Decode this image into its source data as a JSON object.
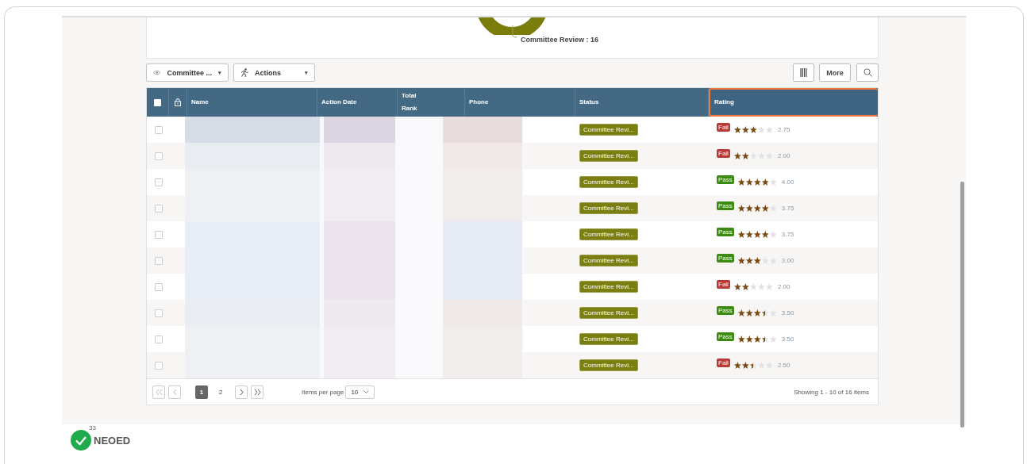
{
  "chart": {
    "label": "Committee Review : 16"
  },
  "toolbar": {
    "view": {
      "label": "Committee ...",
      "caret": "▾"
    },
    "actions": {
      "label": "Actions",
      "caret": "▾"
    },
    "more": {
      "label": "More"
    }
  },
  "table": {
    "header_checkbox": {
      "checked": false
    },
    "columns": [
      {
        "label": "Name",
        "highlighted": false
      },
      {
        "label": "Action Date",
        "highlighted": false
      },
      {
        "label": "Total Rank",
        "highlighted": false
      },
      {
        "label": "Phone",
        "highlighted": false
      },
      {
        "label": "Status",
        "highlighted": false
      },
      {
        "label": "Rating",
        "highlighted": true
      }
    ],
    "rows": [
      {
        "checked": false,
        "status": "Committee Revi...",
        "result": {
          "kind": "fail",
          "label": "Fail"
        },
        "stars": 3,
        "score": "2.75"
      },
      {
        "checked": false,
        "status": "Committee Revi...",
        "result": {
          "kind": "fail",
          "label": "Fail"
        },
        "stars": 2,
        "score": "2.00"
      },
      {
        "checked": false,
        "status": "Committee Revi...",
        "result": {
          "kind": "pass",
          "label": "Pass"
        },
        "stars": 4,
        "score": "4.00"
      },
      {
        "checked": false,
        "status": "Committee Revi...",
        "result": {
          "kind": "pass",
          "label": "Pass"
        },
        "stars": 4,
        "score": "3.75"
      },
      {
        "checked": false,
        "status": "Committee Revi...",
        "result": {
          "kind": "pass",
          "label": "Pass"
        },
        "stars": 4,
        "score": "3.75"
      },
      {
        "checked": false,
        "status": "Committee Revi...",
        "result": {
          "kind": "pass",
          "label": "Pass"
        },
        "stars": 3,
        "score": "3.00"
      },
      {
        "checked": false,
        "status": "Committee Revi...",
        "result": {
          "kind": "fail",
          "label": "Fail"
        },
        "stars": 2,
        "score": "2.00"
      },
      {
        "checked": false,
        "status": "Committee Revi...",
        "result": {
          "kind": "pass",
          "label": "Pass"
        },
        "stars": 3.5,
        "score": "3.50"
      },
      {
        "checked": false,
        "status": "Committee Revi...",
        "result": {
          "kind": "pass",
          "label": "Pass"
        },
        "stars": 3.5,
        "score": "3.50"
      },
      {
        "checked": false,
        "status": "Committee Revi...",
        "result": {
          "kind": "fail",
          "label": "Fail"
        },
        "stars": 2.5,
        "score": "2.50"
      }
    ]
  },
  "pagination": {
    "pages": [
      {
        "label": "1",
        "selected": true
      },
      {
        "label": "2",
        "selected": false
      }
    ],
    "per_page_label": "Items per page",
    "per_page": "10",
    "summary": "Showing 1 - 10 of 16 items"
  },
  "footer": {
    "logo_badge": "33",
    "logo_text": "NEOED"
  }
}
